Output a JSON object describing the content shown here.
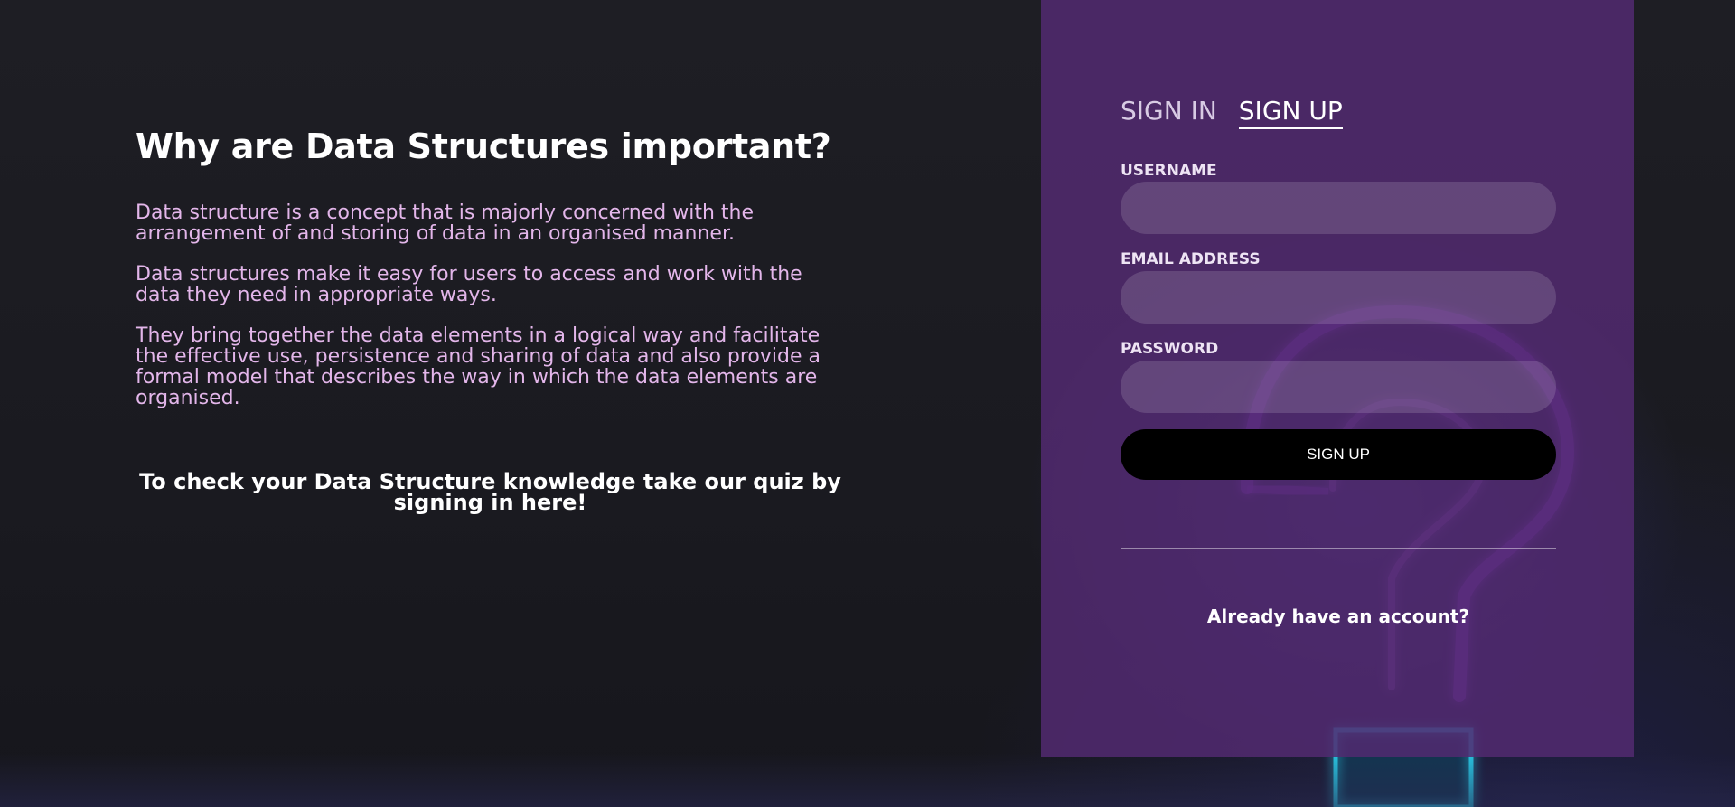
{
  "info": {
    "title": "Why are Data Structures important?",
    "paragraphs": [
      "Data structure is a concept that is majorly concerned with the arrangement of and storing of data in an organised manner.",
      "Data structures make it easy for users to access and work with the data they need in appropriate ways.",
      "They bring together the data elements in a logical way and facilitate the effective use, persistence and sharing of data and also provide a formal model that describes the way in which the data elements are organised."
    ],
    "cta": "To check your Data Structure knowledge take our quiz by signing in here!"
  },
  "auth": {
    "tabs": [
      {
        "label": "SIGN IN",
        "active": false
      },
      {
        "label": "SIGN UP",
        "active": true
      }
    ],
    "fields": {
      "username": {
        "label": "USERNAME",
        "value": "",
        "placeholder": ""
      },
      "email": {
        "label": "EMAIL ADDRESS",
        "value": "",
        "placeholder": ""
      },
      "password": {
        "label": "PASSWORD",
        "value": "",
        "placeholder": ""
      }
    },
    "submit_label": "SIGN UP",
    "switch_link": "Already have an account?"
  },
  "background": {
    "neon_shape": "question-mark",
    "neon_color": "#a040e8",
    "neon_base_color": "#2ad4f0"
  },
  "colors": {
    "page_bg": "#1c1c22",
    "panel_bg": "#522a70",
    "paragraph_text": "#e3b6ea",
    "button_bg": "#000000"
  }
}
